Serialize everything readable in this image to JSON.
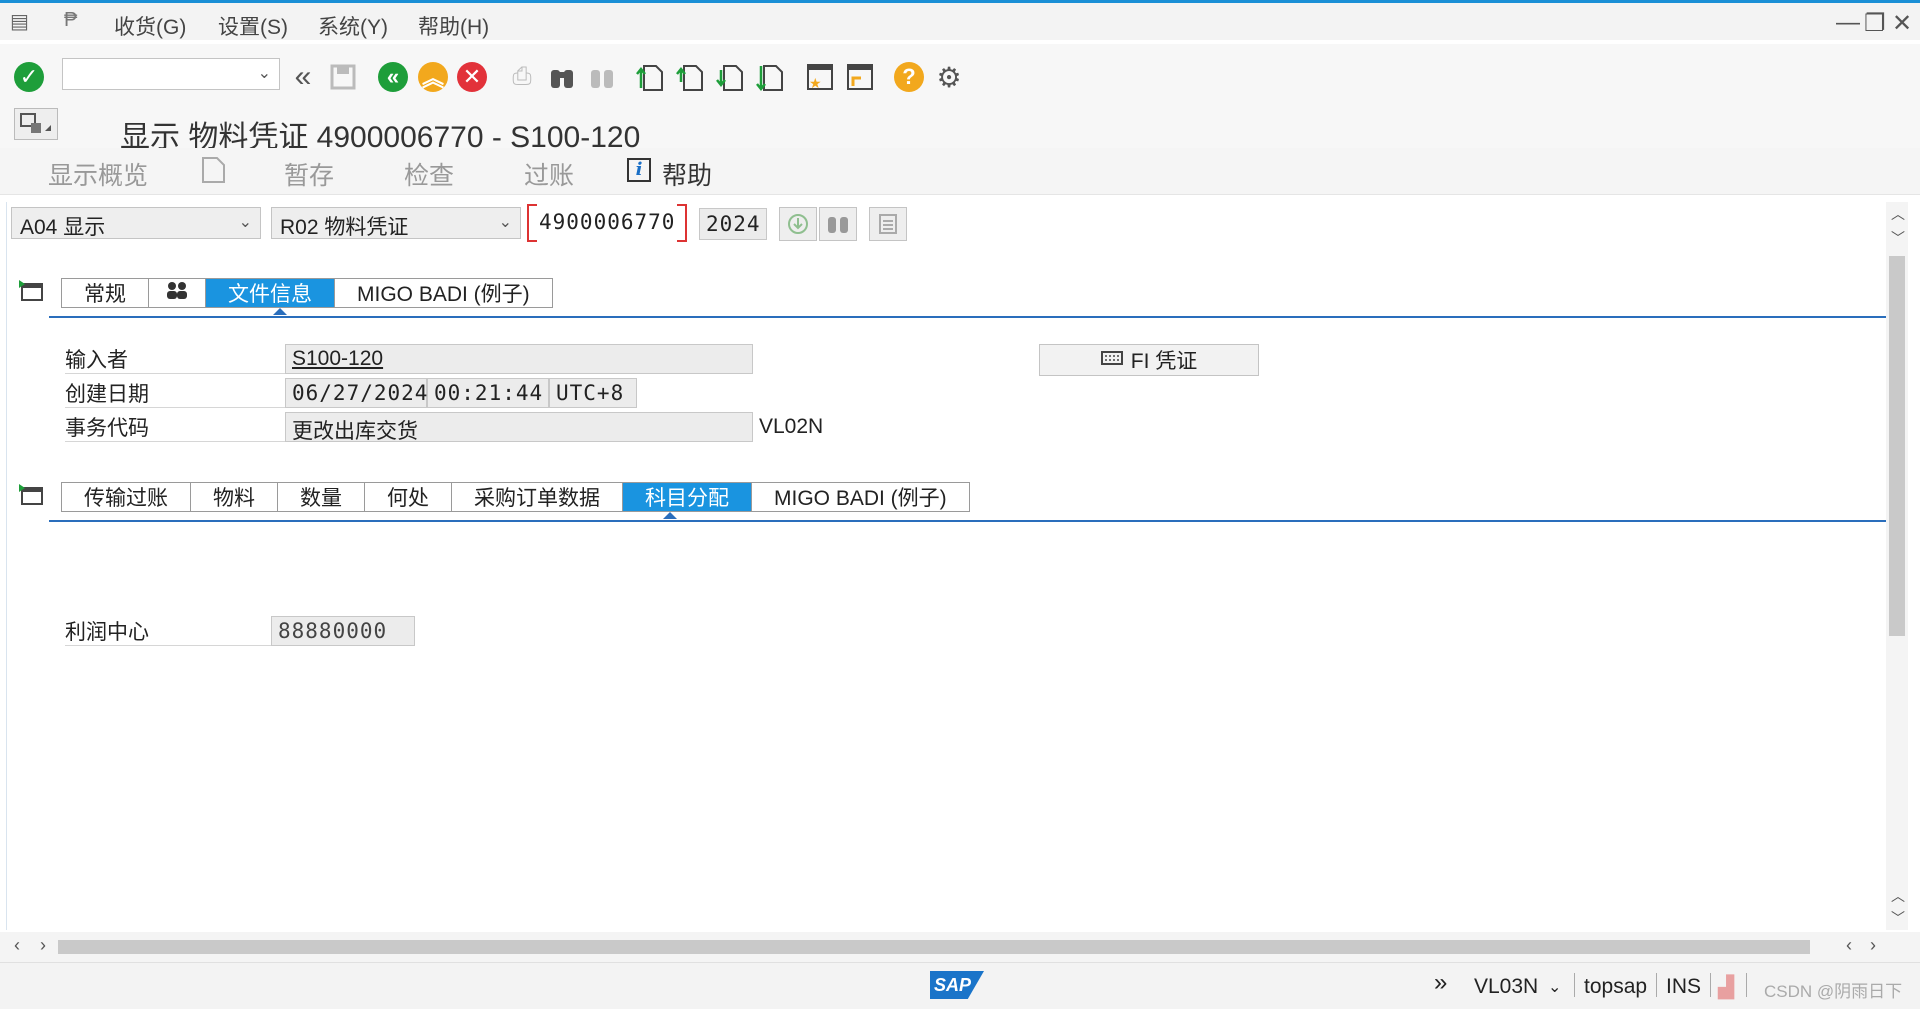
{
  "menu": {
    "items": [
      "收货(G)",
      "设置(S)",
      "系统(Y)",
      "帮助(H)"
    ]
  },
  "toolbar": {
    "command_field_value": "",
    "icons": [
      "check-icon",
      "back-double-icon",
      "save-icon",
      "back-icon",
      "exit-icon",
      "cancel-icon",
      "print-icon",
      "find-icon",
      "find-next-icon",
      "first-page-icon",
      "prev-page-icon",
      "next-page-icon",
      "last-page-icon",
      "create-session-icon",
      "shortcut-icon",
      "help-icon",
      "settings-icon"
    ]
  },
  "title": {
    "text": "显示 物料凭证 4900006770 - S100-120"
  },
  "app_toolbar": {
    "overview": "显示概览",
    "hold": "暂存",
    "check": "检查",
    "post": "过账",
    "help": "帮助"
  },
  "selectors": {
    "action": "A04 显示",
    "reference": "R02 物料凭证",
    "document_number": "4900006770",
    "year": "2024"
  },
  "header_tabs": {
    "tabs": [
      "常规",
      "文件信息",
      "MIGO BADI (例子)"
    ],
    "active": "文件信息"
  },
  "header_fields": {
    "entered_by_label": "输入者",
    "entered_by": "S100-120",
    "created_on_label": "创建日期",
    "created_date": "06/27/2024",
    "created_time": "00:21:44",
    "timezone": "UTC+8",
    "transaction_label": "事务代码",
    "transaction_text": "更改出库交货",
    "transaction_code": "VL02N",
    "fi_button": "FI 凭证"
  },
  "item_tabs": {
    "tabs": [
      "传输过账",
      "物料",
      "数量",
      "何处",
      "采购订单数据",
      "科目分配",
      "MIGO BADI (例子)"
    ],
    "active": "科目分配"
  },
  "item_fields": {
    "profit_center_label": "利润中心",
    "profit_center": "88880000"
  },
  "statusbar": {
    "transaction": "VL03N",
    "server": "topsap",
    "mode": "INS",
    "watermark": "CSDN @阴雨日下"
  },
  "colors": {
    "accent": "#1a94e0",
    "tab_line": "#2a6ebc",
    "ok_green": "#1e9e3a",
    "cancel_red": "#e2323a",
    "warn_orange": "#f2a81d"
  }
}
